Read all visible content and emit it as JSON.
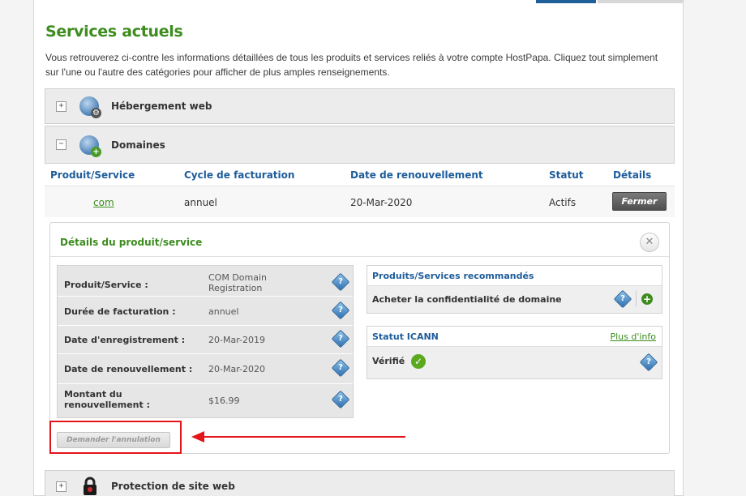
{
  "colors": {
    "heading_green": "#3c8c1e",
    "link_blue": "#1d5c9a",
    "annotation_red": "#e4141b"
  },
  "page": {
    "title": "Services actuels",
    "intro": "Vous retrouverez ci-contre les informations détaillées de tous les produits et services reliés à votre compte HostPapa. Cliquez tout simplement sur l'une ou l'autre des catégories pour afficher de plus amples renseignements."
  },
  "categories": [
    {
      "label": "Hébergement web",
      "toggle": "+",
      "icon": "globe-icon"
    },
    {
      "label": "Domaines",
      "toggle": "−",
      "icon": "globe-plus-icon"
    },
    {
      "label": "Protection de site web",
      "toggle": "+",
      "icon": "lock-icon"
    }
  ],
  "domains_table": {
    "headers": [
      "Produit/Service",
      "Cycle de facturation",
      "Date de renouvellement",
      "Statut",
      "Détails"
    ],
    "row": {
      "product": "com",
      "cycle": "annuel",
      "renewal": "20-Mar-2020",
      "status": "Actifs",
      "button": "Fermer"
    }
  },
  "details": {
    "title": "Détails du produit/service",
    "close_icon": "close-icon",
    "rows": [
      {
        "label": "Produit/Service :",
        "value": "COM Domain Registration"
      },
      {
        "label": "Durée de facturation :",
        "value": "annuel"
      },
      {
        "label": "Date d'enregistrement :",
        "value": "20-Mar-2019"
      },
      {
        "label": "Date de renouvellement :",
        "value": "20-Mar-2020"
      },
      {
        "label": "Montant du renouvellement :",
        "value": "$16.99"
      }
    ],
    "recommended": {
      "title": "Produits/Services recommandés",
      "item": "Acheter la confidentialité de domaine"
    },
    "icann": {
      "title": "Statut ICANN",
      "link": "Plus d'info",
      "status": "Vérifié"
    },
    "cancel_button": "Demander l'annulation"
  }
}
